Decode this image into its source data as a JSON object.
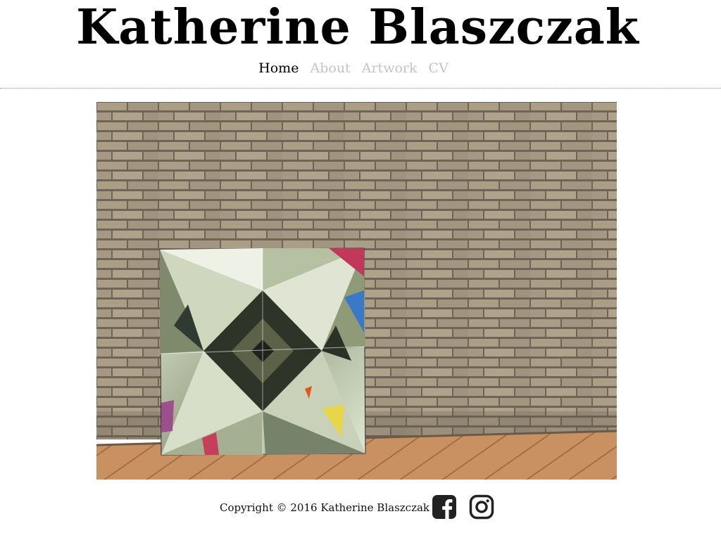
{
  "site": {
    "title": "Katherine Blaszczak"
  },
  "nav": {
    "items": [
      {
        "label": "Home",
        "active": true
      },
      {
        "label": "About",
        "active": false
      },
      {
        "label": "Artwork",
        "active": false
      },
      {
        "label": "CV",
        "active": false
      }
    ]
  },
  "colors": {
    "nav_active": "#000000",
    "nav_inactive": "#c4c4c4",
    "brick": "#a79a82",
    "mortar": "#6d6356",
    "deck": "#c58d5e",
    "icon": "#222222"
  },
  "footer": {
    "copyright": "Copyright © 2016 Katherine Blaszczak",
    "social": [
      {
        "icon": "facebook-icon"
      },
      {
        "icon": "instagram-icon"
      }
    ]
  }
}
